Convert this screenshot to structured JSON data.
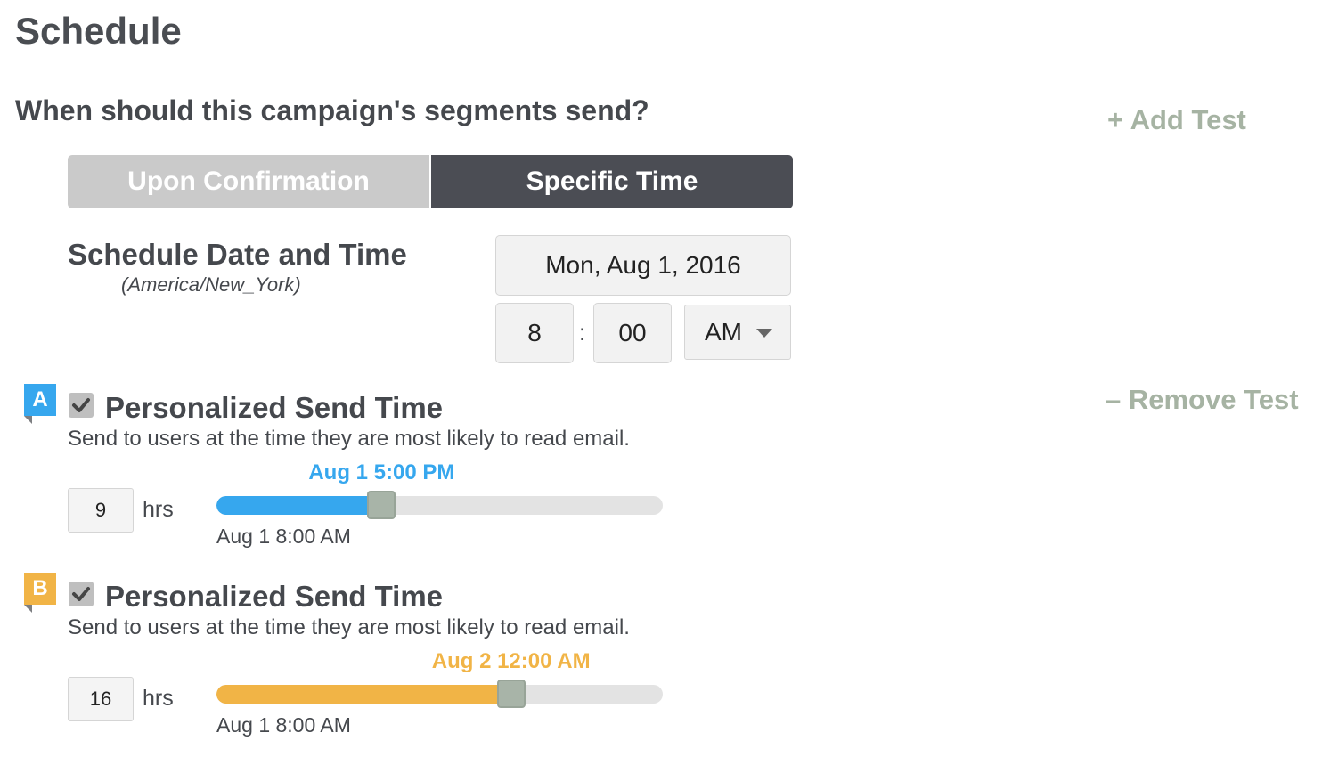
{
  "page": {
    "title": "Schedule",
    "question": "When should this campaign's segments send?",
    "add_test": "+ Add Test",
    "remove_test": "– Remove Test"
  },
  "send_mode": {
    "options": [
      "Upon Confirmation",
      "Specific Time"
    ],
    "selected": "Specific Time"
  },
  "schedule": {
    "label": "Schedule Date and Time",
    "timezone": "(America/New_York)",
    "date": "Mon, Aug 1, 2016",
    "hour": "8",
    "separator": ":",
    "minute": "00",
    "ampm": "AM"
  },
  "tests": [
    {
      "badge": "A",
      "badge_color": "#36a7ee",
      "checked": true,
      "title": "Personalized Send Time",
      "description": "Send to users at the time they are most likely to read email.",
      "hours": "9",
      "hours_unit": "hrs",
      "slider_label": "Aug 1 5:00 PM",
      "slider_start": "Aug 1 8:00 AM",
      "slider_fraction": 0.37
    },
    {
      "badge": "B",
      "badge_color": "#f1b446",
      "checked": true,
      "title": "Personalized Send Time",
      "description": "Send to users at the time they are most likely to read email.",
      "hours": "16",
      "hours_unit": "hrs",
      "slider_label": "Aug 2 12:00 AM",
      "slider_start": "Aug 1 8:00 AM",
      "slider_fraction": 0.66
    }
  ]
}
